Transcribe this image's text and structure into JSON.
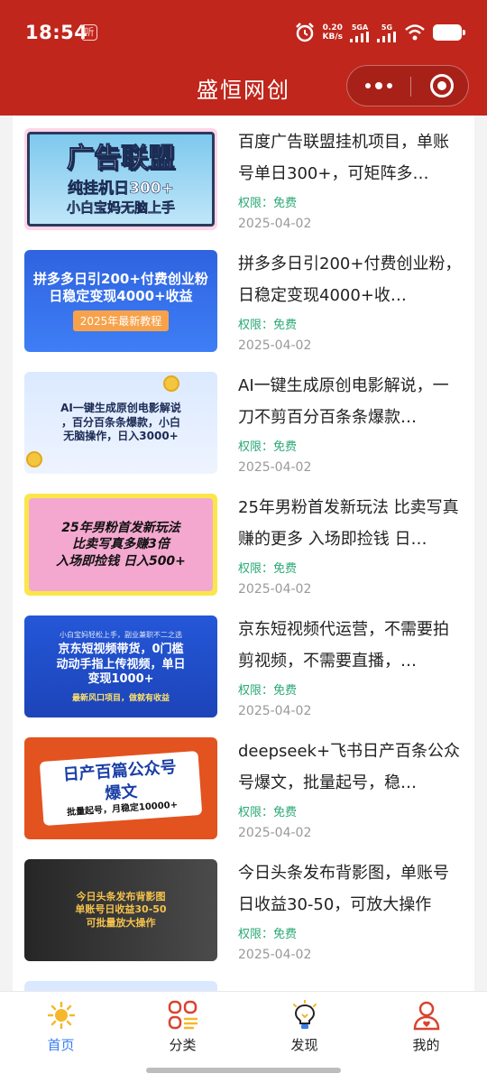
{
  "status_bar": {
    "time": "18:54",
    "badge": "听",
    "net_speed_value": "0.20",
    "net_speed_unit": "KB/s",
    "signal1": "5GA",
    "signal2": "5G"
  },
  "header": {
    "title": "盛恒网创"
  },
  "list": {
    "items": [
      {
        "title": "百度广告联盟挂机项目，单账号单日300+，可矩阵多…",
        "permission": "权限：免费",
        "date": "2025-04-02",
        "thumb": {
          "line1": "广告联盟",
          "line2": "纯挂机日300+",
          "line3": "小白宝妈无脑上手"
        }
      },
      {
        "title": "拼多多日引200+付费创业粉，日稳定变现4000+收…",
        "permission": "权限：免费",
        "date": "2025-04-02",
        "thumb": {
          "line1": "拼多多日引200+付费创业粉",
          "line2": "日稳定变现4000+收益",
          "tag": "2025年最新教程"
        }
      },
      {
        "title": "AI一键生成原创电影解说，一刀不剪百分百条条爆款…",
        "permission": "权限：免费",
        "date": "2025-04-02",
        "thumb": {
          "line1": "AI一键生成原创电影解说",
          "line2": "，百分百条条爆款，小白",
          "line3": "无脑操作，日入3000+"
        }
      },
      {
        "title": "25年男粉首发新玩法 比卖写真赚的更多 入场即捡钱 日…",
        "permission": "权限：免费",
        "date": "2025-04-02",
        "thumb": {
          "line1": "25年男粉首发新玩法",
          "line2": "比卖写真多赚3倍",
          "line3": "入场即捡钱 日入500+"
        }
      },
      {
        "title": "京东短视频代运营，不需要拍剪视频，不需要直播，…",
        "permission": "权限：免费",
        "date": "2025-04-02",
        "thumb": {
          "top": "小白宝妈轻松上手，副业兼职不二之选",
          "line1": "京东短视频带货，0门槛",
          "line2": "动动手指上传视频，单日",
          "line3": "变现1000+",
          "foot": "最新风口项目，做就有收益"
        }
      },
      {
        "title": "deepseek+飞书日产百条公众号爆文，批量起号，稳…",
        "permission": "权限：免费",
        "date": "2025-04-02",
        "thumb": {
          "line1": "日产百篇公众号",
          "line2": "爆文",
          "line3": "批量起号，月稳定10000+"
        }
      },
      {
        "title": "今日头条发布背影图，单账号日收益30-50，可放大操作",
        "permission": "权限：免费",
        "date": "2025-04-02",
        "thumb": {
          "line1": "今日头条发布背影图",
          "line2": "单账号日收益30-50",
          "line3": "可批量放大操作"
        }
      }
    ]
  },
  "tabbar": {
    "tabs": [
      {
        "label": "首页",
        "icon": "sun-home-icon",
        "active": true
      },
      {
        "label": "分类",
        "icon": "category-grid-icon",
        "active": false
      },
      {
        "label": "发现",
        "icon": "lightbulb-icon",
        "active": false
      },
      {
        "label": "我的",
        "icon": "user-profile-icon",
        "active": false
      }
    ]
  },
  "colors": {
    "header_bg": "#c0261c",
    "permission": "#2aa876",
    "tab_active": "#3a7df0"
  }
}
